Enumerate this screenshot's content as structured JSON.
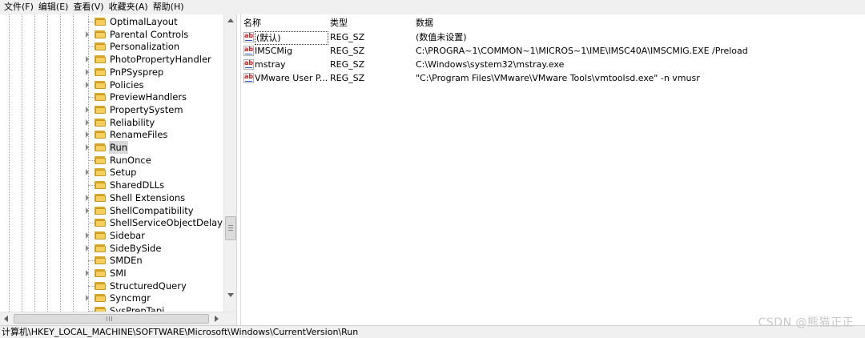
{
  "menubar": {
    "items": [
      "文件(F)",
      "编辑(E)",
      "查看(V)",
      "收藏夹(A)",
      "帮助(H)"
    ]
  },
  "tree": {
    "items": [
      {
        "label": "OptimalLayout",
        "expandable": false,
        "selected": false
      },
      {
        "label": "Parental Controls",
        "expandable": true,
        "selected": false
      },
      {
        "label": "Personalization",
        "expandable": false,
        "selected": false
      },
      {
        "label": "PhotoPropertyHandler",
        "expandable": true,
        "selected": false
      },
      {
        "label": "PnPSysprep",
        "expandable": true,
        "selected": false
      },
      {
        "label": "Policies",
        "expandable": true,
        "selected": false
      },
      {
        "label": "PreviewHandlers",
        "expandable": false,
        "selected": false
      },
      {
        "label": "PropertySystem",
        "expandable": true,
        "selected": false
      },
      {
        "label": "Reliability",
        "expandable": true,
        "selected": false
      },
      {
        "label": "RenameFiles",
        "expandable": true,
        "selected": false
      },
      {
        "label": "Run",
        "expandable": true,
        "selected": true
      },
      {
        "label": "RunOnce",
        "expandable": false,
        "selected": false
      },
      {
        "label": "Setup",
        "expandable": true,
        "selected": false
      },
      {
        "label": "SharedDLLs",
        "expandable": false,
        "selected": false
      },
      {
        "label": "Shell Extensions",
        "expandable": true,
        "selected": false
      },
      {
        "label": "ShellCompatibility",
        "expandable": true,
        "selected": false
      },
      {
        "label": "ShellServiceObjectDelayLoad",
        "expandable": false,
        "selected": false
      },
      {
        "label": "Sidebar",
        "expandable": true,
        "selected": false
      },
      {
        "label": "SideBySide",
        "expandable": true,
        "selected": false
      },
      {
        "label": "SMDEn",
        "expandable": false,
        "selected": false
      },
      {
        "label": "SMI",
        "expandable": true,
        "selected": false
      },
      {
        "label": "StructuredQuery",
        "expandable": false,
        "selected": false
      },
      {
        "label": "Syncmgr",
        "expandable": true,
        "selected": false
      },
      {
        "label": "SysPrepTapi",
        "expandable": false,
        "selected": false
      }
    ],
    "hscroll_grip": "|||"
  },
  "list": {
    "headers": {
      "name": "名称",
      "type": "类型",
      "data": "数据"
    },
    "rows": [
      {
        "name": "(默认)",
        "type": "REG_SZ",
        "data": "(数值未设置)",
        "focused": true
      },
      {
        "name": "IMSCMig",
        "type": "REG_SZ",
        "data": "C:\\PROGRA~1\\COMMON~1\\MICROS~1\\IME\\IMSC40A\\IMSCMIG.EXE /Preload",
        "focused": false
      },
      {
        "name": "mstray",
        "type": "REG_SZ",
        "data": "C:\\Windows\\system32\\mstray.exe",
        "focused": false
      },
      {
        "name": "VMware User P...",
        "type": "REG_SZ",
        "data": "\"C:\\Program Files\\VMware\\VMware Tools\\vmtoolsd.exe\" -n vmusr",
        "focused": false
      }
    ],
    "value_icon": "ab"
  },
  "statusbar": {
    "path": "计算机\\HKEY_LOCAL_MACHINE\\SOFTWARE\\Microsoft\\Windows\\CurrentVersion\\Run"
  },
  "watermark": "CSDN @熊猫正正"
}
